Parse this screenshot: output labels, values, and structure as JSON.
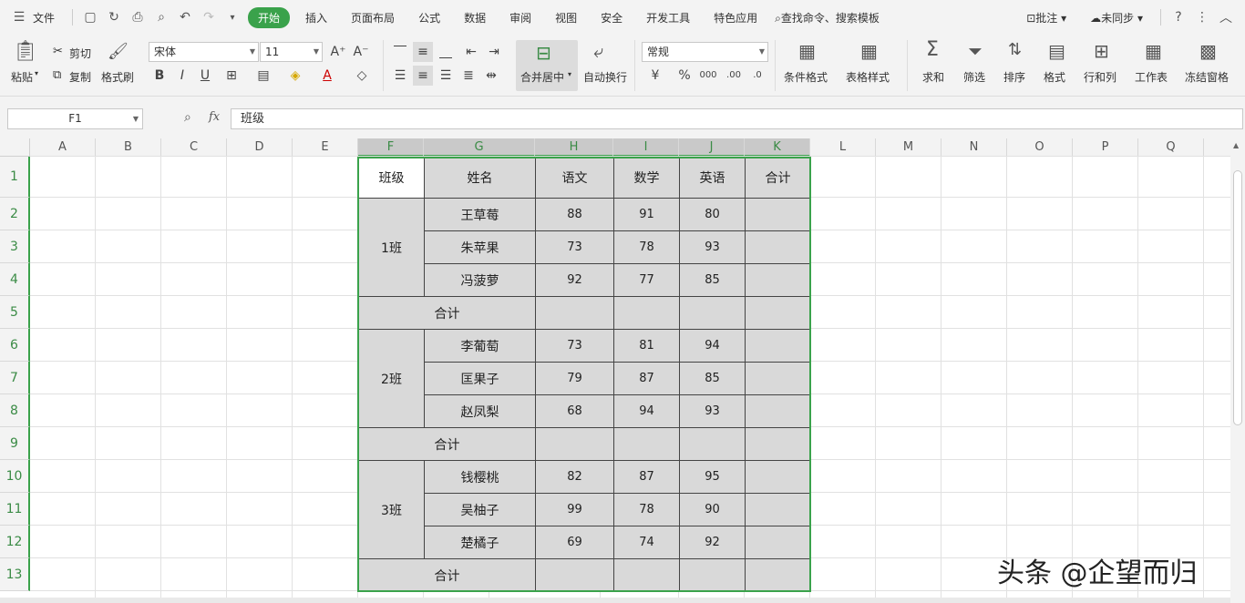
{
  "menu": {
    "file": "文件",
    "tabs": [
      "开始",
      "插入",
      "页面布局",
      "公式",
      "数据",
      "审阅",
      "视图",
      "安全",
      "开发工具",
      "特色应用"
    ],
    "search": "查找命令、搜索模板",
    "comment": "批注",
    "sync": "未同步"
  },
  "ribbon": {
    "paste": "粘贴",
    "cut": "剪切",
    "copy": "复制",
    "format_painter": "格式刷",
    "font_name": "宋体",
    "font_size": "11",
    "merge_center": "合并居中",
    "wrap": "自动换行",
    "number_format": "常规",
    "cond_format": "条件格式",
    "table_style": "表格样式",
    "sum": "求和",
    "filter": "筛选",
    "sort": "排序",
    "format": "格式",
    "row_col": "行和列",
    "worksheet": "工作表",
    "freeze": "冻结窗格"
  },
  "formula_bar": {
    "cell_ref": "F1",
    "fx": "fx",
    "content": "班级"
  },
  "columns": [
    "A",
    "B",
    "C",
    "D",
    "E",
    "F",
    "G",
    "H",
    "I",
    "J",
    "K",
    "L",
    "M",
    "N",
    "O",
    "P",
    "Q"
  ],
  "rows": [
    "1",
    "2",
    "3",
    "4",
    "5",
    "6",
    "7",
    "8",
    "9",
    "10",
    "11",
    "12",
    "13"
  ],
  "table": {
    "headers": [
      "班级",
      "姓名",
      "语文",
      "数学",
      "英语",
      "合计"
    ],
    "groups": [
      {
        "class": "1班",
        "students": [
          {
            "name": "王草莓",
            "chinese": "88",
            "math": "91",
            "english": "80"
          },
          {
            "name": "朱苹果",
            "chinese": "73",
            "math": "78",
            "english": "93"
          },
          {
            "name": "冯菠萝",
            "chinese": "92",
            "math": "77",
            "english": "85"
          }
        ],
        "subtotal": "合计"
      },
      {
        "class": "2班",
        "students": [
          {
            "name": "李葡萄",
            "chinese": "73",
            "math": "81",
            "english": "94"
          },
          {
            "name": "匡果子",
            "chinese": "79",
            "math": "87",
            "english": "85"
          },
          {
            "name": "赵凤梨",
            "chinese": "68",
            "math": "94",
            "english": "93"
          }
        ],
        "subtotal": "合计"
      },
      {
        "class": "3班",
        "students": [
          {
            "name": "钱樱桃",
            "chinese": "82",
            "math": "87",
            "english": "95"
          },
          {
            "name": "吴柚子",
            "chinese": "99",
            "math": "78",
            "english": "90"
          },
          {
            "name": "楚橘子",
            "chinese": "69",
            "math": "74",
            "english": "92"
          }
        ],
        "subtotal": "合计"
      }
    ]
  },
  "watermark": "头条 @企望而归",
  "colors": {
    "accent": "#3aa24b",
    "table_fill": "#d9d9d9"
  }
}
